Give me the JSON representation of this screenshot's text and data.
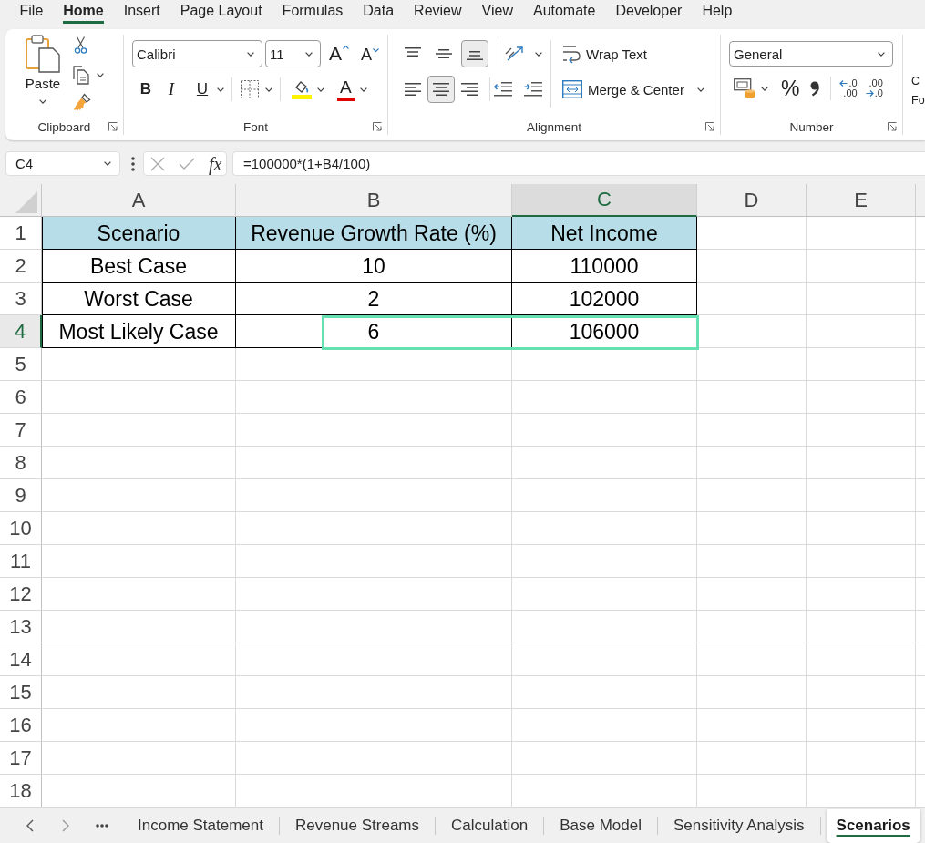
{
  "menu_tabs": [
    {
      "label": "File",
      "selected": false
    },
    {
      "label": "Home",
      "selected": true
    },
    {
      "label": "Insert",
      "selected": false
    },
    {
      "label": "Page Layout",
      "selected": false
    },
    {
      "label": "Formulas",
      "selected": false
    },
    {
      "label": "Data",
      "selected": false
    },
    {
      "label": "Review",
      "selected": false
    },
    {
      "label": "View",
      "selected": false
    },
    {
      "label": "Automate",
      "selected": false
    },
    {
      "label": "Developer",
      "selected": false
    },
    {
      "label": "Help",
      "selected": false
    }
  ],
  "ribbon": {
    "clipboard": {
      "title": "Clipboard",
      "paste_label": "Paste"
    },
    "font": {
      "title": "Font",
      "font_name": "Calibri",
      "font_size": "11",
      "grow_font_label": "A",
      "shrink_font_label": "A",
      "bold_label": "B",
      "italic_label": "I",
      "underline_label": "U",
      "font_color_label": "A"
    },
    "alignment": {
      "title": "Alignment",
      "vertical": [
        {
          "kind": "top",
          "selected": false
        },
        {
          "kind": "middle",
          "selected": false
        },
        {
          "kind": "bottom",
          "selected": true
        }
      ],
      "horizontal": [
        {
          "kind": "left",
          "selected": false
        },
        {
          "kind": "center",
          "selected": true
        },
        {
          "kind": "right",
          "selected": false
        }
      ],
      "wrap_text": "Wrap Text",
      "merge_center": "Merge & Center"
    },
    "number": {
      "title": "Number",
      "format": "General",
      "percent_label": "%",
      "decimal_buttons": [
        {
          "kind": "increase",
          "lines": [
            ".0",
            ".00"
          ]
        },
        {
          "kind": "decrease",
          "lines": [
            ".00",
            ".0"
          ]
        }
      ]
    },
    "next_group": {
      "label_lines": [
        "C",
        "Fo"
      ]
    }
  },
  "formula_bar": {
    "name_box": "C4",
    "function_label": "fx",
    "formula": "=100000*(1+B4/100)"
  },
  "sheet": {
    "columns": [
      {
        "label": "A",
        "selected": false
      },
      {
        "label": "B",
        "selected": false
      },
      {
        "label": "C",
        "selected": true
      },
      {
        "label": "D",
        "selected": false
      },
      {
        "label": "E",
        "selected": false
      }
    ],
    "rows": [
      {
        "label": "1",
        "selected": false,
        "highlighted": false,
        "kind": "header",
        "cells": [
          "Scenario",
          "Revenue Growth Rate (%)",
          "Net Income"
        ]
      },
      {
        "label": "2",
        "selected": false,
        "highlighted": false,
        "kind": "data",
        "cells": [
          "Best Case",
          "10",
          "110000"
        ]
      },
      {
        "label": "3",
        "selected": false,
        "highlighted": false,
        "kind": "data",
        "cells": [
          "Worst Case",
          "2",
          "102000"
        ]
      },
      {
        "label": "4",
        "selected": true,
        "highlighted": true,
        "kind": "data",
        "cells": [
          "Most Likely Case",
          "6",
          "106000"
        ]
      },
      {
        "label": "5",
        "selected": false,
        "highlighted": false,
        "kind": "empty"
      },
      {
        "label": "6",
        "selected": false,
        "highlighted": false,
        "kind": "empty"
      },
      {
        "label": "7",
        "selected": false,
        "highlighted": false,
        "kind": "empty"
      },
      {
        "label": "8",
        "selected": false,
        "highlighted": false,
        "kind": "empty"
      },
      {
        "label": "9",
        "selected": false,
        "highlighted": false,
        "kind": "empty"
      },
      {
        "label": "10",
        "selected": false,
        "highlighted": false,
        "kind": "empty"
      },
      {
        "label": "11",
        "selected": false,
        "highlighted": false,
        "kind": "empty"
      },
      {
        "label": "12",
        "selected": false,
        "highlighted": false,
        "kind": "empty"
      },
      {
        "label": "13",
        "selected": false,
        "highlighted": false,
        "kind": "empty"
      },
      {
        "label": "14",
        "selected": false,
        "highlighted": false,
        "kind": "empty"
      },
      {
        "label": "15",
        "selected": false,
        "highlighted": false,
        "kind": "empty"
      },
      {
        "label": "16",
        "selected": false,
        "highlighted": false,
        "kind": "empty"
      },
      {
        "label": "17",
        "selected": false,
        "highlighted": false,
        "kind": "empty"
      },
      {
        "label": "18",
        "selected": false,
        "highlighted": false,
        "kind": "empty"
      }
    ]
  },
  "sheet_tabs": [
    {
      "label": "Income Statement",
      "selected": false
    },
    {
      "label": "Revenue Streams",
      "selected": false
    },
    {
      "label": "Calculation",
      "selected": false
    },
    {
      "label": "Base Model",
      "selected": false
    },
    {
      "label": "Sensitivity Analysis",
      "selected": false
    },
    {
      "label": "Scenarios",
      "selected": true
    }
  ]
}
